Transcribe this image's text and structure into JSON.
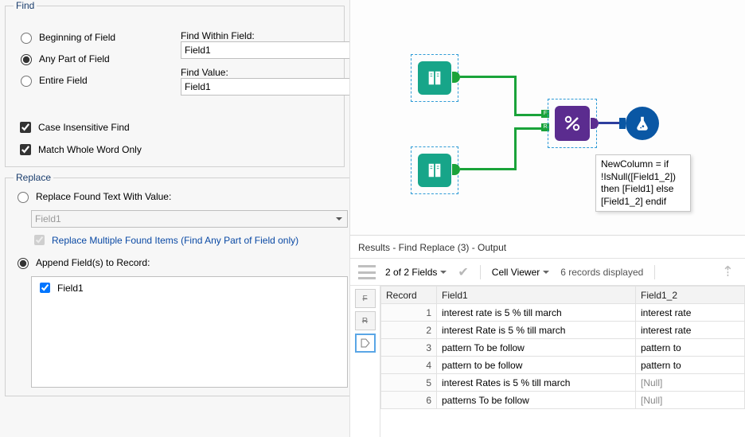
{
  "find": {
    "legend": "Find",
    "options": {
      "beginning": "Beginning of Field",
      "anypart": "Any Part of Field",
      "entire": "Entire Field",
      "selected": "anypart"
    },
    "within_label": "Find Within Field:",
    "within_value": "Field1",
    "value_label": "Find Value:",
    "value_value": "Field1",
    "case_insensitive": "Case Insensitive Find",
    "whole_word": "Match Whole Word Only"
  },
  "replace": {
    "legend": "Replace",
    "replace_value_label": "Replace Found Text With Value:",
    "replace_value": "Field1",
    "multiple_label": "Replace Multiple Found Items (Find Any Part of Field only)",
    "append_label": "Append Field(s) to Record:",
    "selected": "append",
    "fields": [
      {
        "label": "Field1",
        "checked": true
      }
    ]
  },
  "canvas": {
    "annotation": "NewColumn = if !IsNull([Field1_2]) then [Field1] else [Field1_2] endif"
  },
  "results": {
    "title": "Results - Find Replace (3) - Output",
    "fieldcount": "2 of 2 Fields",
    "cellviewer": "Cell Viewer",
    "recordcount": "6 records displayed",
    "columns": {
      "record": "Record",
      "c1": "Field1",
      "c2": "Field1_2"
    },
    "rows": [
      {
        "rec": "1",
        "c1": "interest rate is 5 % till march",
        "c2": "interest rate"
      },
      {
        "rec": "2",
        "c1": "interest Rate is 5 % till march",
        "c2": "interest rate"
      },
      {
        "rec": "3",
        "c1": "pattern To be follow",
        "c2": "pattern to"
      },
      {
        "rec": "4",
        "c1": "pattern to be follow",
        "c2": "pattern to"
      },
      {
        "rec": "5",
        "c1": "interest Rates is 5 % till march",
        "c2": "[Null]"
      },
      {
        "rec": "6",
        "c1": "patterns To be follow",
        "c2": "[Null]"
      }
    ]
  }
}
